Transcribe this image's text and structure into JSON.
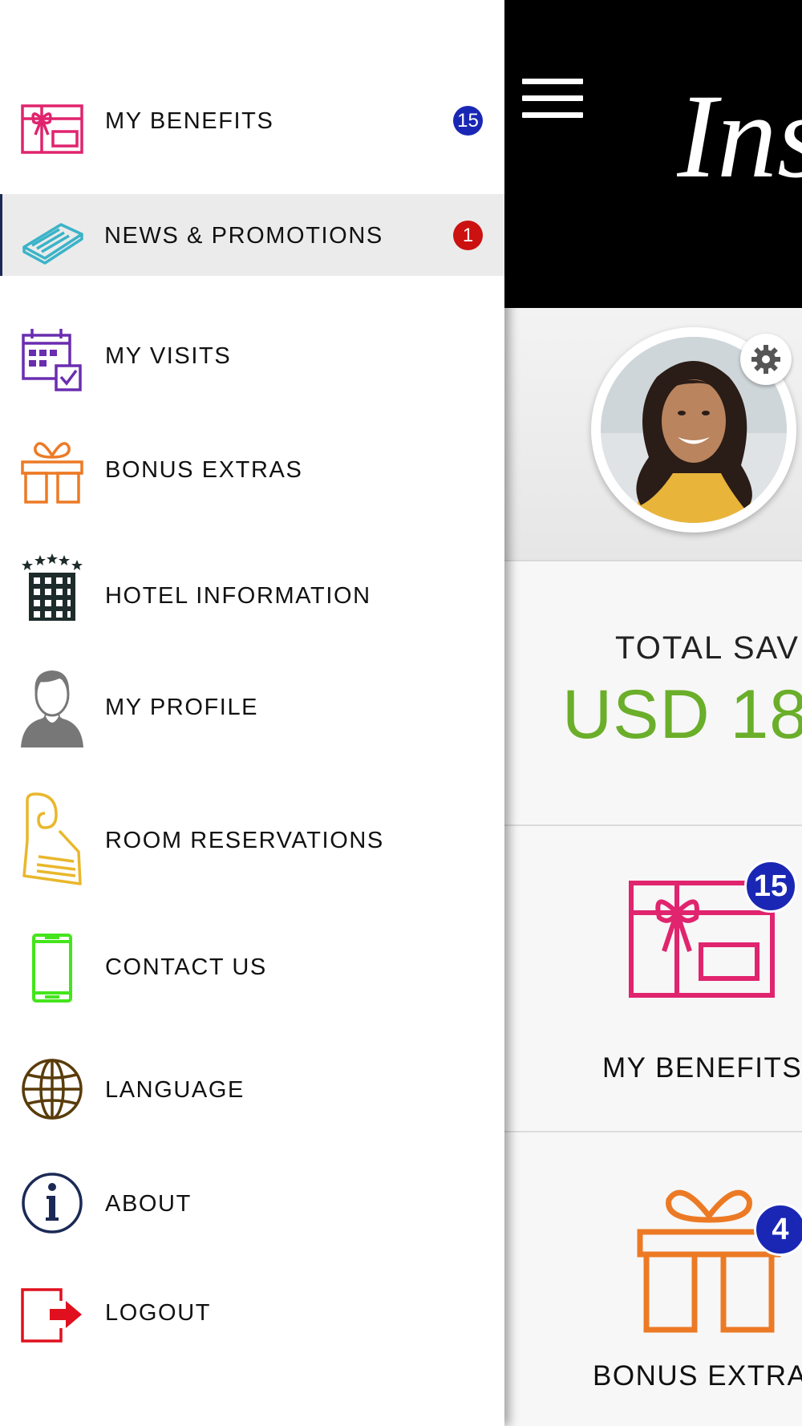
{
  "drawer": {
    "items": [
      {
        "label": "MY BENEFITS",
        "badge": "15",
        "badge_color": "#1a27b5",
        "icon": "gift-card-icon"
      },
      {
        "label": "NEWS & PROMOTIONS",
        "badge": "1",
        "badge_color": "#cc1111",
        "icon": "newspaper-icon",
        "active": true
      },
      {
        "label": "MY VISITS",
        "icon": "calendar-check-icon"
      },
      {
        "label": "BONUS EXTRAS",
        "icon": "gift-box-icon"
      },
      {
        "label": "HOTEL INFORMATION",
        "icon": "hotel-building-icon"
      },
      {
        "label": "MY PROFILE",
        "icon": "person-icon"
      },
      {
        "label": "ROOM RESERVATIONS",
        "icon": "door-hanger-icon"
      },
      {
        "label": "CONTACT US",
        "icon": "phone-icon"
      },
      {
        "label": "LANGUAGE",
        "icon": "globe-icon"
      },
      {
        "label": "ABOUT",
        "icon": "info-icon"
      },
      {
        "label": "LOGOUT",
        "icon": "logout-icon"
      }
    ]
  },
  "main": {
    "logo_text": "Ins",
    "savings": {
      "label": "TOTAL SAV",
      "value": "USD 18"
    },
    "tiles": [
      {
        "label": "MY BENEFITS",
        "badge": "15",
        "icon": "gift-card-icon"
      },
      {
        "label": "BONUS EXTRA",
        "badge": "4",
        "icon": "gift-box-icon"
      }
    ]
  },
  "colors": {
    "benefits": "#e0246e",
    "news": "#3bb3c8",
    "visits": "#6a2db0",
    "bonus": "#ec7a25",
    "hotel": "#1d2b2a",
    "profile": "#777777",
    "reservations": "#e9b72b",
    "contact": "#44e51c",
    "language": "#5a3c0a",
    "about": "#1b2a55",
    "logout": "#e0101e",
    "savings_green": "#6aae2a",
    "badge_blue": "#1a27b5"
  }
}
